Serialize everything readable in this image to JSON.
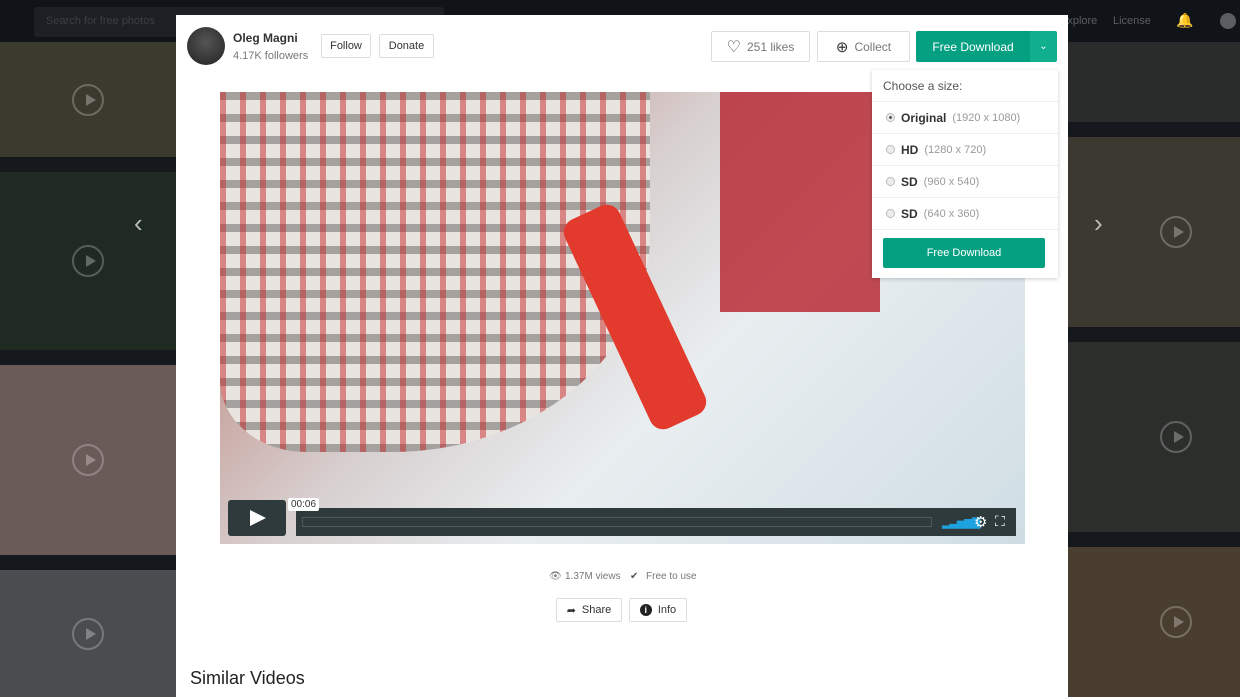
{
  "topbar": {
    "search_placeholder": "Search for free photos",
    "explore": "Explore",
    "license": "License"
  },
  "author": {
    "name": "Oleg Magni",
    "followers": "4.17K followers",
    "follow": "Follow",
    "donate": "Donate"
  },
  "actions": {
    "likes": "251 likes",
    "collect": "Collect",
    "download": "Free Download"
  },
  "dropdown": {
    "title": "Choose a size:",
    "options": [
      {
        "label": "Original",
        "size": "(1920 x 1080)",
        "selected": true
      },
      {
        "label": "HD",
        "size": "(1280 x 720)"
      },
      {
        "label": "SD",
        "size": "(960 x 540)"
      },
      {
        "label": "SD",
        "size": "(640 x 360)"
      }
    ],
    "download": "Free Download"
  },
  "player": {
    "time": "00:06",
    "progress": 0
  },
  "stats": {
    "views": "1.37M views",
    "license": "Free to use"
  },
  "buttons": {
    "share": "Share",
    "info": "Info"
  },
  "similar_title": "Similar Videos"
}
